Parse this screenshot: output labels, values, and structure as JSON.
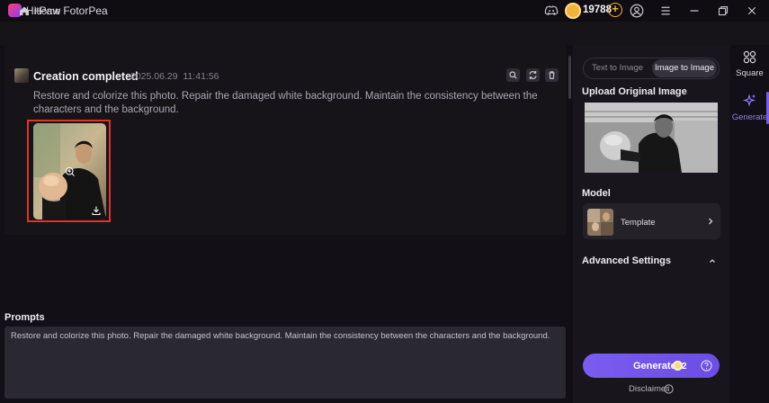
{
  "app": {
    "title": "HitPaw FotorPea"
  },
  "titlebar": {
    "credits": "19788",
    "add_credits": "+"
  },
  "breadcrumb": {
    "home_label": "Home"
  },
  "creation": {
    "status": "Creation completed",
    "date": "2025.06.29",
    "time": "11:41:56",
    "prompt": "Restore and colorize this photo. Repair the damaged white background. Maintain the consistency between the characters and the background."
  },
  "prompts": {
    "label": "Prompts",
    "text": "Restore and colorize this photo. Repair the damaged white background. Maintain the consistency between the characters and the background."
  },
  "right_panel": {
    "tabs": [
      "Text to Image",
      "Image to Image"
    ],
    "active_tab": "Image to Image",
    "upload_label": "Upload Original Image",
    "model_label": "Model",
    "model_name": "Template",
    "advanced_label": "Advanced Settings",
    "generate_label": "Generate",
    "generate_cost": "2",
    "disclaimer": "Disclaimer"
  },
  "side_nav": {
    "items": [
      "Square",
      "Generate"
    ],
    "active": "Generate"
  },
  "colors": {
    "accent": "#7b5cf0",
    "highlight_border": "#e0332c",
    "coin": "#f2b33a"
  }
}
